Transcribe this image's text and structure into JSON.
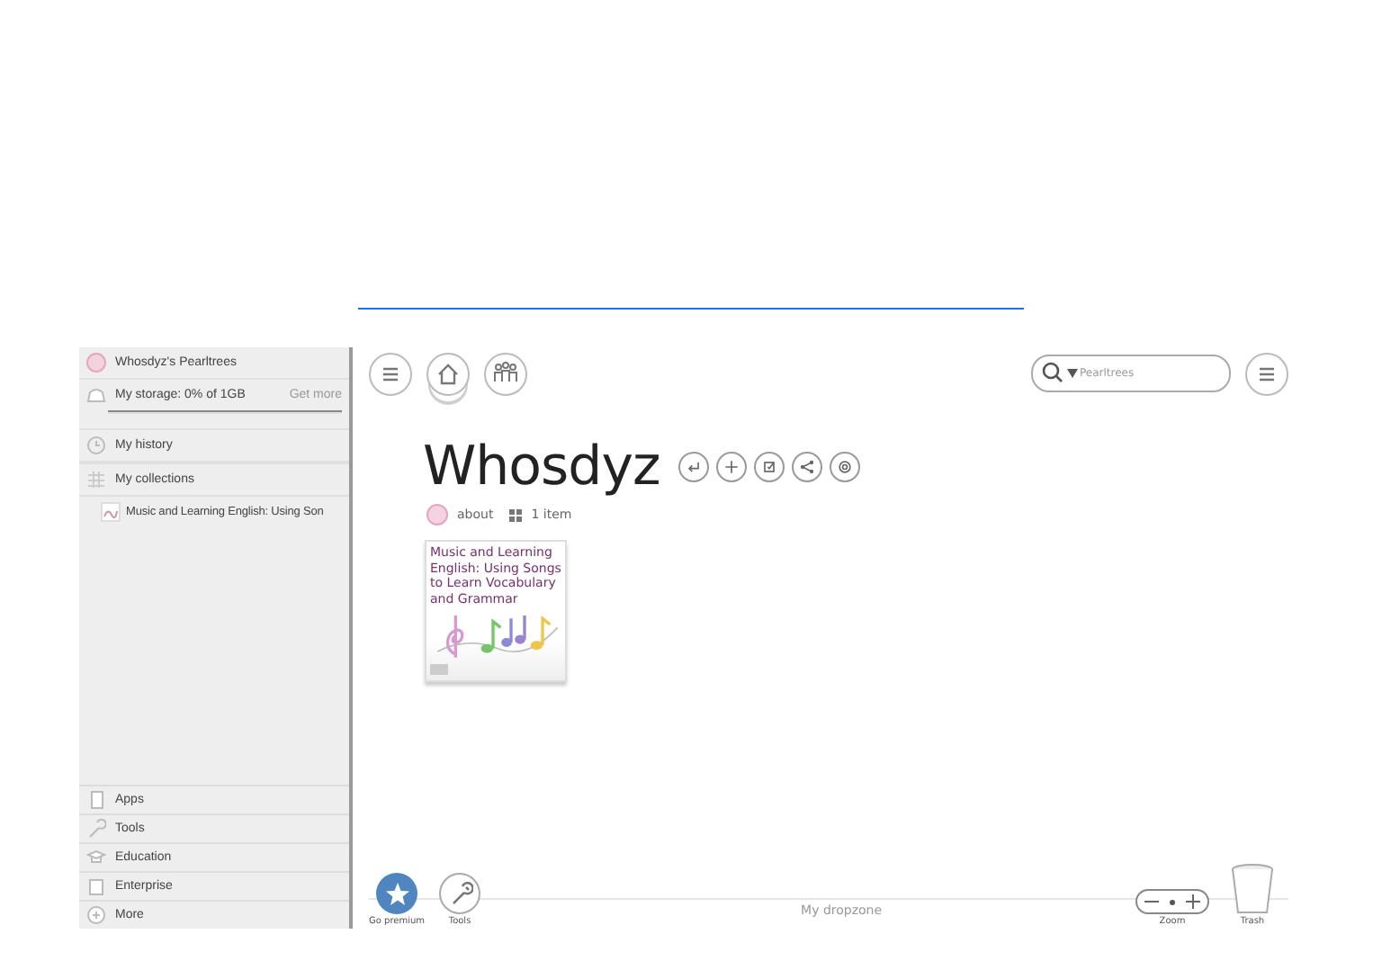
{
  "sidebar": {
    "profile": "Whosdyz's Pearltrees",
    "storage": {
      "label": "My storage: 0% of 1GB",
      "action": "Get more"
    },
    "items": [
      {
        "label": "My history"
      },
      {
        "label": "My collections",
        "children": [
          {
            "label": "Music and Learning English: Using Son"
          }
        ]
      }
    ],
    "bottom_items": [
      {
        "label": "Apps"
      },
      {
        "label": "Tools"
      },
      {
        "label": "Education"
      },
      {
        "label": "Enterprise"
      },
      {
        "label": "More"
      }
    ]
  },
  "nav": [
    {
      "kind": "menu",
      "selected": false
    },
    {
      "kind": "home",
      "selected": true
    },
    {
      "kind": "team",
      "selected": false
    }
  ],
  "search": {
    "placeholder": "Pearltrees"
  },
  "collection": {
    "title": "Whosdyz",
    "about": "about",
    "count": "1 item"
  },
  "cards": [
    {
      "title": "Music and Learning English: Using Songs to Learn Vocabulary and Grammar"
    }
  ],
  "bottom_bar": {
    "premium": "Go premium",
    "tools": "Tools",
    "dropzone": "My dropzone",
    "zoom": "Zoom",
    "trash": "Trash"
  }
}
